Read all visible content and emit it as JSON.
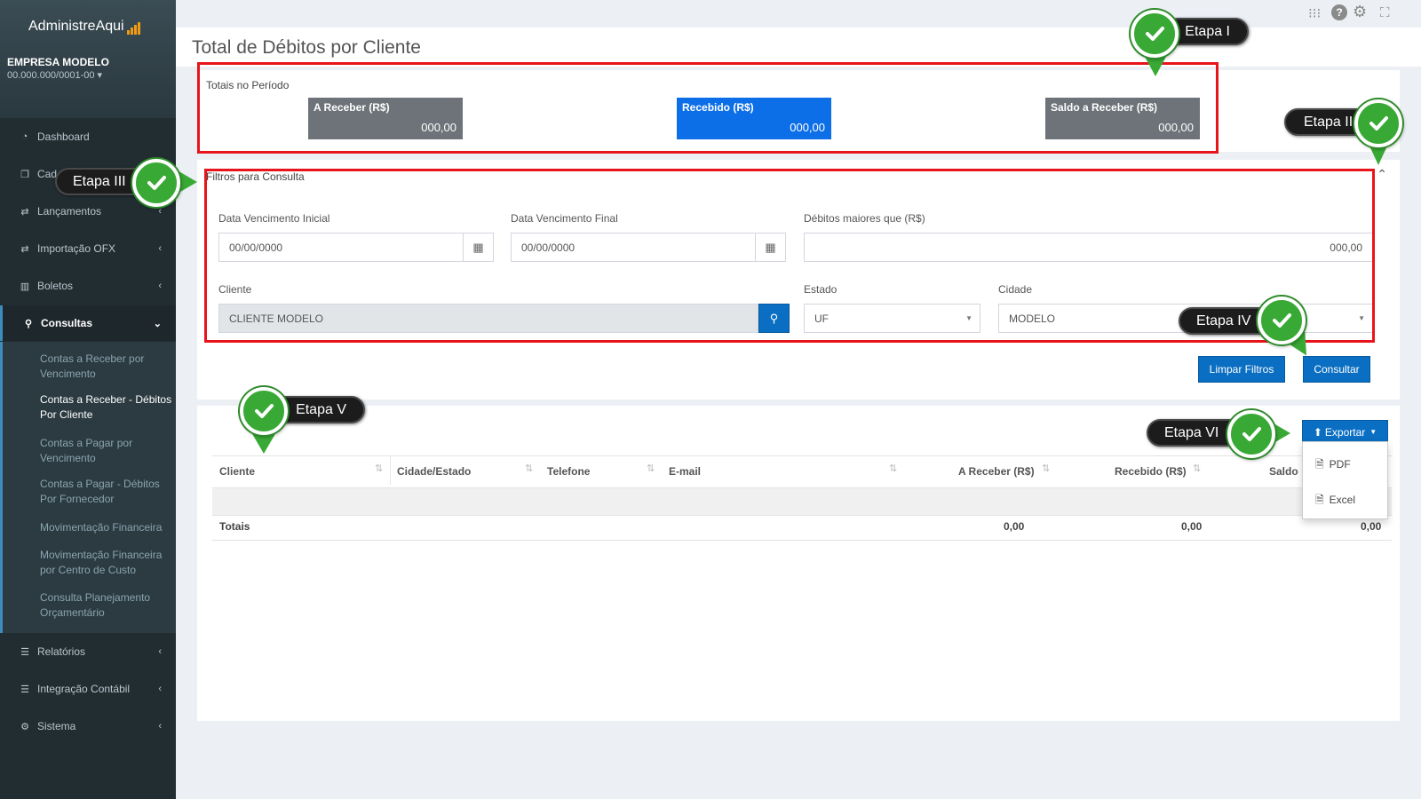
{
  "app": {
    "logo_text": "AdministreAqui",
    "company": "EMPRESA MODELO",
    "cnpj": "00.000.000/0001-00 ▾"
  },
  "sidebar": {
    "items": [
      {
        "icon": "dashboard-icon",
        "label": "Dashboard",
        "chevron": ""
      },
      {
        "icon": "copy-icon",
        "label": "Cad",
        "chevron": ""
      },
      {
        "icon": "exchange-icon",
        "label": "Lançamentos",
        "chevron": "‹"
      },
      {
        "icon": "exchange-icon",
        "label": "Importação OFX",
        "chevron": "‹"
      },
      {
        "icon": "barcode-icon",
        "label": "Boletos",
        "chevron": "‹"
      },
      {
        "icon": "search-icon",
        "label": "Consultas",
        "chevron": "⌄"
      },
      {
        "icon": "list-icon",
        "label": "Relatórios",
        "chevron": "‹"
      },
      {
        "icon": "list-icon",
        "label": "Integração Contábil",
        "chevron": "‹"
      },
      {
        "icon": "cogs-icon",
        "label": "Sistema",
        "chevron": "‹"
      }
    ],
    "submenu": [
      "Contas a Receber por Vencimento",
      "Contas a Receber - Débitos Por Cliente",
      "Contas a Pagar por Vencimento",
      "Contas a Pagar - Débitos Por Fornecedor",
      "Movimentação Financeira",
      "Movimentação Financeira por Centro de Custo",
      "Consulta Planejamento Orçamentário"
    ]
  },
  "page": {
    "title": "Total de Débitos por Cliente"
  },
  "totals": {
    "title": "Totais no Período",
    "a_receber_label": "A Receber (R$)",
    "a_receber_value": "000,00",
    "recebido_label": "Recebido (R$)",
    "recebido_value": "000,00",
    "saldo_label": "Saldo a Receber (R$)",
    "saldo_value": "000,00",
    "colors": {
      "gray": "#6d7378",
      "blue": "#0d6fe8"
    }
  },
  "filters": {
    "title": "Filtros para Consulta",
    "data_inicial_label": "Data Vencimento Inicial",
    "data_inicial_value": "00/00/0000",
    "data_final_label": "Data Vencimento Final",
    "data_final_value": "00/00/0000",
    "debitos_label": "Débitos maiores que (R$)",
    "debitos_value": "000,00",
    "cliente_label": "Cliente",
    "cliente_value": "CLIENTE MODELO",
    "estado_label": "Estado",
    "estado_value": "UF",
    "cidade_label": "Cidade",
    "cidade_value": "MODELO",
    "limpar_button": "Limpar Filtros",
    "consultar_button": "Consultar"
  },
  "table": {
    "export_button": "Exportar",
    "export_options": [
      "PDF",
      "Excel"
    ],
    "columns": [
      "Cliente",
      "Cidade/Estado",
      "Telefone",
      "E-mail",
      "A Receber (R$)",
      "Recebido (R$)",
      "Saldo"
    ],
    "totals_label": "Totais",
    "totals": [
      "0,00",
      "0,00",
      "0,00"
    ]
  },
  "annotations": {
    "etapa1": "Etapa I",
    "etapa2": "Etapa II",
    "etapa3": "Etapa III",
    "etapa4": "Etapa IV",
    "etapa5": "Etapa V",
    "etapa6": "Etapa VI",
    "accent": "#e8141b",
    "badge_color": "#39a935"
  }
}
